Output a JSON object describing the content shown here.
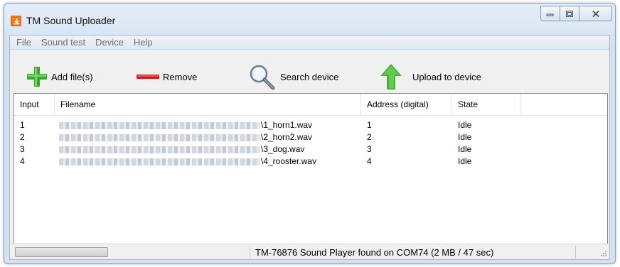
{
  "window": {
    "title": "TM Sound Uploader"
  },
  "menu": [
    "File",
    "Sound test",
    "Device",
    "Help"
  ],
  "toolbar": {
    "add_label": "Add file(s)",
    "remove_label": "Remove",
    "search_label": "Search device",
    "upload_label": "Upload to device"
  },
  "table": {
    "columns": [
      "Input",
      "Filename",
      "Address (digital)",
      "State"
    ],
    "rows": [
      {
        "input": "1",
        "filename": "\\1_horn1.wav",
        "address": "1",
        "state": "Idle"
      },
      {
        "input": "2",
        "filename": "\\2_horn2.wav",
        "address": "2",
        "state": "Idle"
      },
      {
        "input": "3",
        "filename": "\\3_dog.wav",
        "address": "3",
        "state": "Idle"
      },
      {
        "input": "4",
        "filename": "\\4_rooster.wav",
        "address": "4",
        "state": "Idle"
      }
    ]
  },
  "status": {
    "text": "TM-76876 Sound Player found on COM74 (2 MB / 47 sec)",
    "progress": 0
  },
  "icons": {
    "add": "plus-icon",
    "remove": "minus-icon",
    "search": "magnifier-icon",
    "upload": "up-arrow-icon"
  },
  "colors": {
    "add_green": "#3aa82c",
    "remove_red": "#d9141e",
    "upload_green": "#45b531",
    "app_icon_orange": "#f07a1f"
  }
}
